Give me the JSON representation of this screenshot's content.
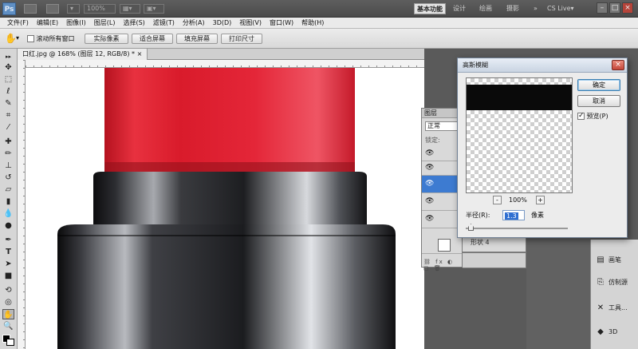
{
  "appbar": {
    "logo": "Ps",
    "zoom": "100%",
    "workspaces": [
      "基本功能",
      "设计",
      "绘画",
      "摄影"
    ],
    "active_workspace": "基本功能",
    "cs_live": "CS Live",
    "window_controls": [
      "–",
      "□",
      "×"
    ]
  },
  "menus": [
    "文件(F)",
    "编辑(E)",
    "图像(I)",
    "图层(L)",
    "选择(S)",
    "滤镜(T)",
    "分析(A)",
    "3D(D)",
    "视图(V)",
    "窗口(W)",
    "帮助(H)"
  ],
  "options": {
    "scroll_all_label": "滚动所有窗口",
    "buttons": [
      "实际像素",
      "适合屏幕",
      "填充屏幕",
      "打印尺寸"
    ]
  },
  "document": {
    "tab_title": "口红.jpg @ 168% (图层 12, RGB/8) *",
    "tab_close": "×"
  },
  "layers_panel": {
    "title": "图层",
    "blend_mode": "正常",
    "lock_label": "锁定:",
    "layer_name": "形状 4"
  },
  "dock_items": [
    {
      "icon": "layers-icon",
      "label": "画笔",
      "glyph": "▤"
    },
    {
      "icon": "history-icon",
      "label": "仿制源",
      "glyph": "⎘"
    },
    {
      "icon": "tools-icon",
      "label": "工具...",
      "glyph": "✕"
    },
    {
      "icon": "3d-icon",
      "label": "3D",
      "glyph": "◆"
    }
  ],
  "dialog": {
    "title": "高斯模糊",
    "close": "×",
    "ok_label": "确定",
    "cancel_label": "取消",
    "preview_label": "预览(P)",
    "preview_checked": true,
    "zoom_minus": "-",
    "zoom_plus": "+",
    "zoom_value": "100%",
    "radius_label": "半径(R):",
    "radius_value": "1.3",
    "radius_unit": "像素"
  },
  "colors": {
    "lipstick_red": "#e52a3a",
    "cap_black": "#1b1c1f",
    "dialog_title_bg": "#c9d4e2"
  }
}
